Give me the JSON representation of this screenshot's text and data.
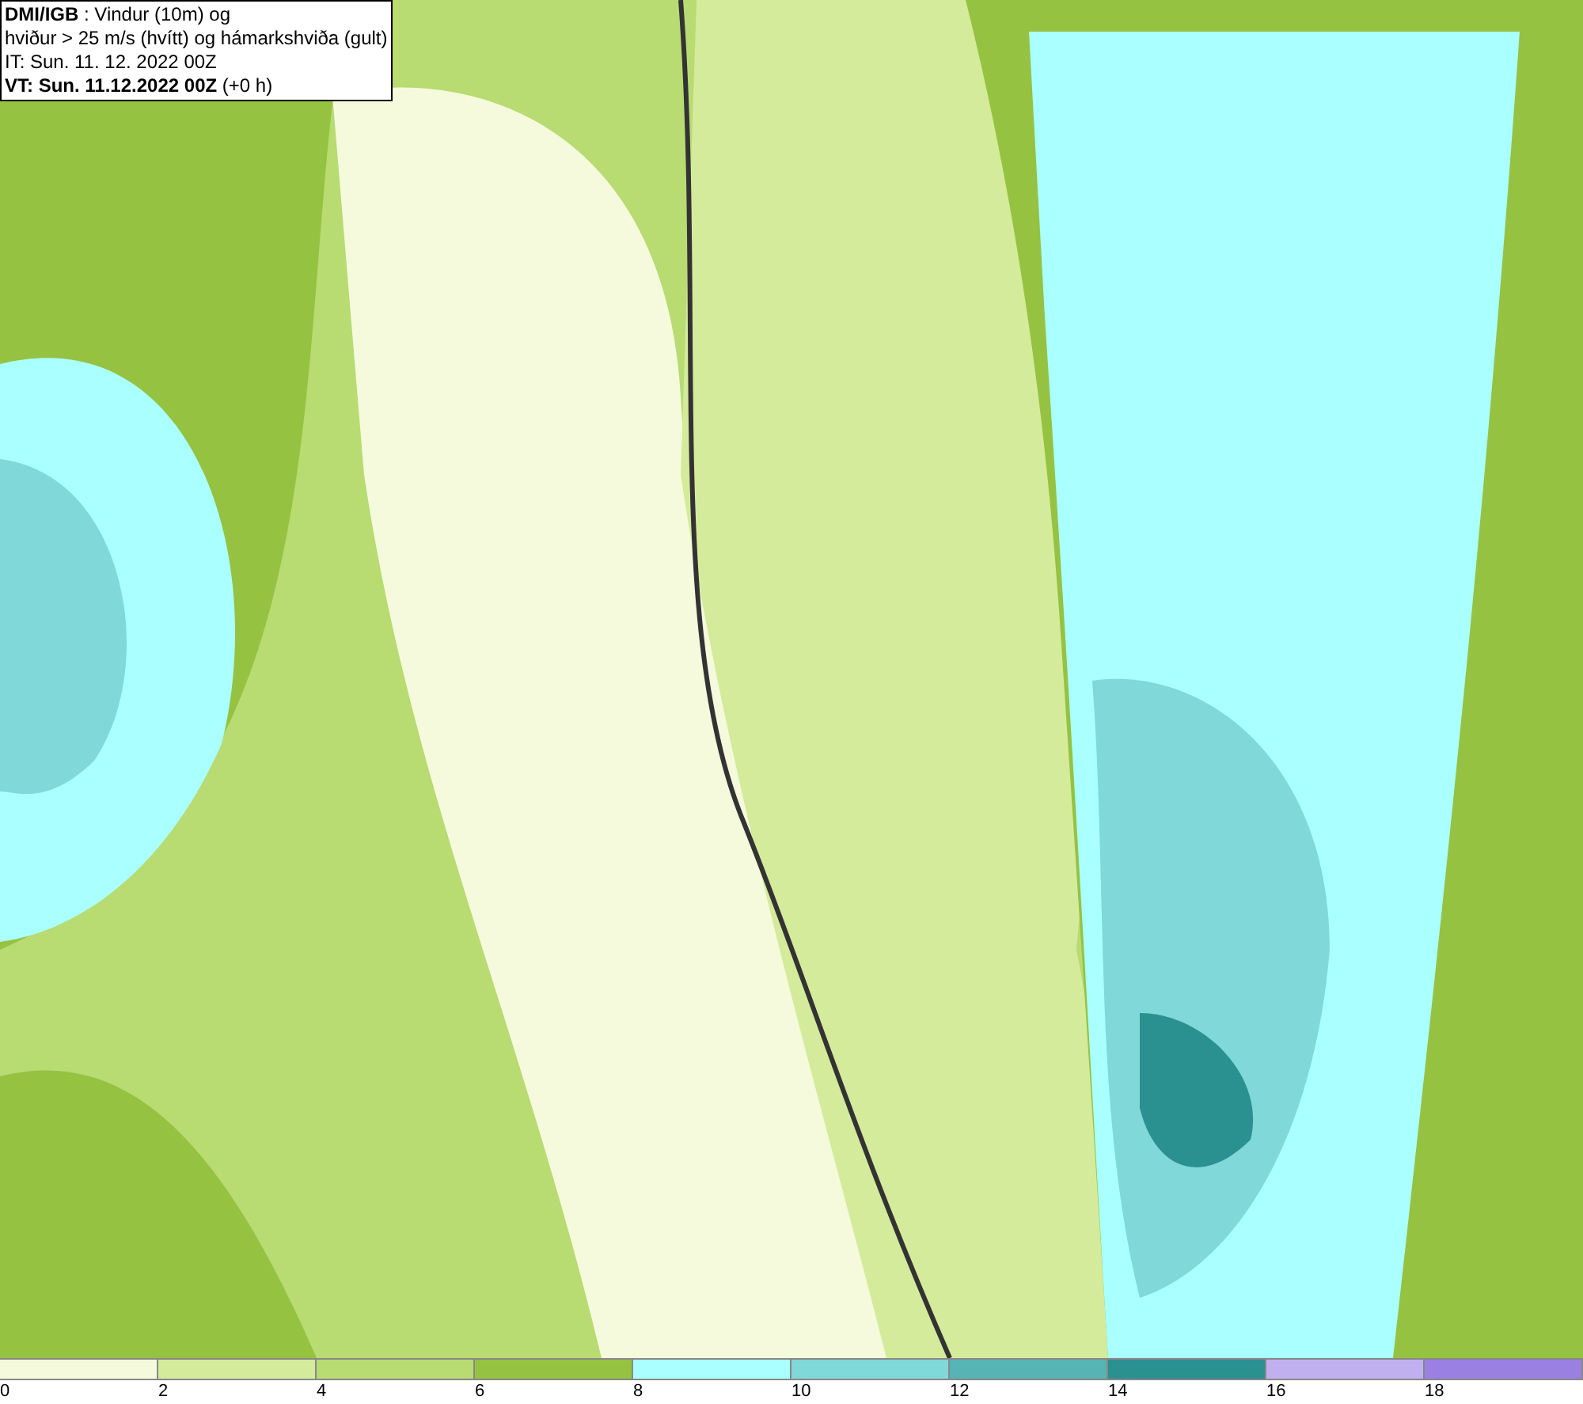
{
  "header": {
    "lines": [
      "**DMI/IGB** : Vindur (10m) og",
      "hviður > 25 m/s (hvítt) og hámarkshviða (gult)",
      "IT: Sun. 11. 12. 2022 00Z",
      "**VT: Sun. 11.12.2022 00Z** (+0 h)"
    ]
  },
  "legend": {
    "bins": [
      {
        "color": "#f5fadc"
      },
      {
        "color": "#d4eb9b"
      },
      {
        "color": "#b8db72"
      },
      {
        "color": "#96c242"
      },
      {
        "color": "#aaffff"
      },
      {
        "color": "#80d8d8"
      },
      {
        "color": "#56b4b4"
      },
      {
        "color": "#2a9090"
      },
      {
        "color": "#c0b0f0"
      },
      {
        "color": "#9a80e0"
      }
    ],
    "ticks": [
      "0",
      "2",
      "4",
      "6",
      "8",
      "10",
      "12",
      "14",
      "16",
      "18"
    ]
  }
}
